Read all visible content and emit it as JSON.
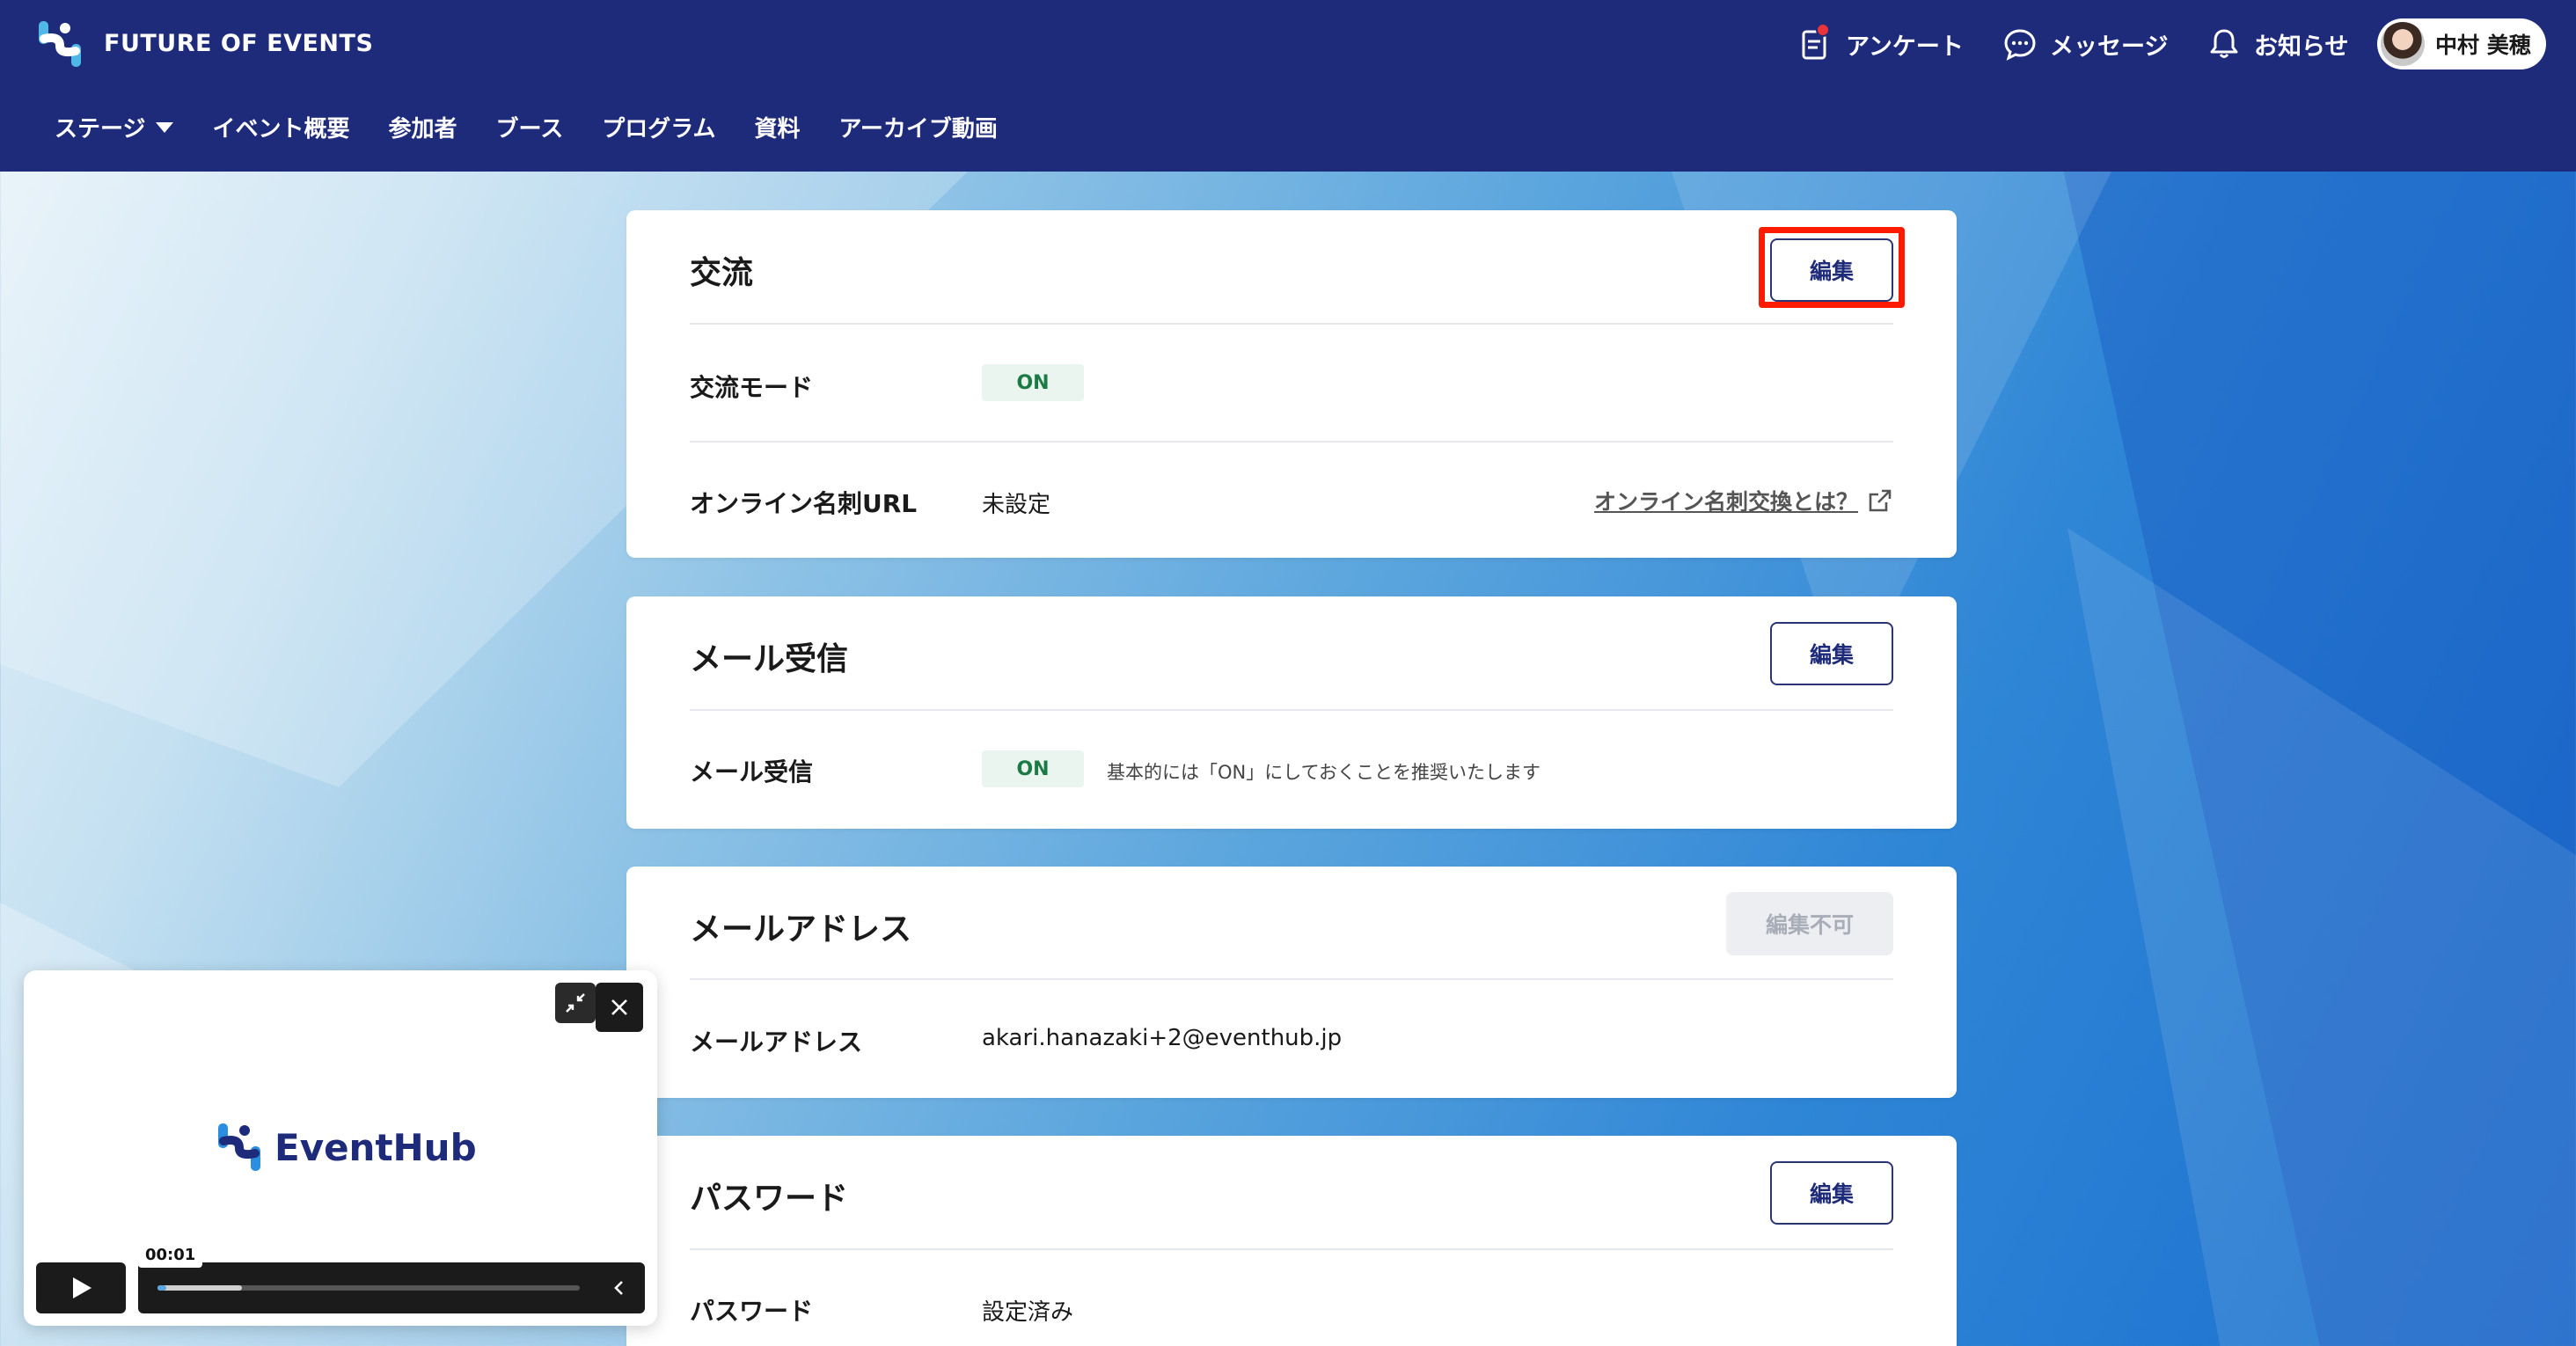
{
  "brand": {
    "name": "FUTURE OF EVENTS"
  },
  "nav": {
    "stage": "ステージ",
    "items": [
      "イベント概要",
      "参加者",
      "ブース",
      "プログラム",
      "資料",
      "アーカイブ動画"
    ]
  },
  "top_actions": {
    "survey": "アンケート",
    "messages": "メッセージ",
    "notifications": "お知らせ",
    "user_name": "中村 美穂"
  },
  "sections": {
    "exchange": {
      "title": "交流",
      "edit_label": "編集",
      "mode_label": "交流モード",
      "mode_value": "ON",
      "url_label": "オンライン名刺URL",
      "url_value": "未設定",
      "help_link": "オンライン名刺交換とは？"
    },
    "mail_receive": {
      "title": "メール受信",
      "edit_label": "編集",
      "row_label": "メール受信",
      "row_value": "ON",
      "hint": "基本的には「ON」にしておくことを推奨いたします"
    },
    "email": {
      "title": "メールアドレス",
      "edit_label": "編集不可",
      "row_label": "メールアドレス",
      "row_value": "akari.hanazaki+2@eventhub.jp"
    },
    "password": {
      "title": "パスワード",
      "edit_label": "編集",
      "row_label": "パスワード",
      "row_value": "設定済み"
    }
  },
  "player": {
    "logo_text": "EventHub",
    "current_time": "00:01",
    "played_fraction": 0.02,
    "buffered_fraction": 0.2
  },
  "colors": {
    "header_bg": "#1e2a7a",
    "highlight": "#ff1a00",
    "on_badge_text": "#1c7a45"
  }
}
